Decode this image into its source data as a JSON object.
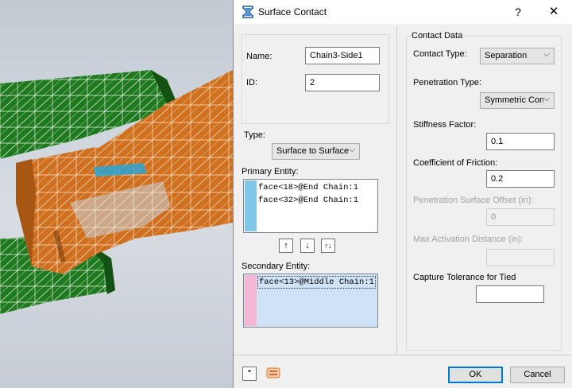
{
  "dialog": {
    "title": "Surface Contact",
    "help": "?",
    "close": "✕"
  },
  "general": {
    "name_label": "Name:",
    "name_value": "Chain3-Side1",
    "id_label": "ID:",
    "id_value": "2"
  },
  "type": {
    "label": "Type:",
    "value": "Surface to Surface"
  },
  "primary": {
    "label": "Primary Entity:",
    "items": [
      "face<18>@End Chain:1",
      "face<32>@End Chain:1"
    ]
  },
  "secondary": {
    "label": "Secondary Entity:",
    "items": [
      "face<13>@Middle Chain:1"
    ]
  },
  "list_buttons": {
    "up": "↑",
    "down": "↓",
    "swap": "↑↓"
  },
  "contact_data": {
    "group_label": "Contact Data",
    "contact_type_label": "Contact Type:",
    "contact_type_value": "Separation",
    "penetration_type_label": "Penetration Type:",
    "penetration_type_value": "Symmetric Cont",
    "stiffness_label": "Stiffness Factor:",
    "stiffness_value": "0.1",
    "friction_label": "Coefficient of Friction:",
    "friction_value": "0.2",
    "pen_offset_label": "Penetration Surface Offset (in):",
    "pen_offset_value": "0",
    "max_activation_label": "Max Activation Distance (in):",
    "max_activation_value": "",
    "capture_tolerance_label": "Capture Tolerance for Tied",
    "capture_tolerance_value": ""
  },
  "footer": {
    "ok": "OK",
    "cancel": "Cancel"
  },
  "colors": {
    "accent": "#0078d7",
    "primary_stripe": "#7fc6e8",
    "secondary_stripe": "#f5b8d4",
    "secondary_bg": "#cfe2f6",
    "mesh_green": "#1f7a1f",
    "mesh_orange": "#cc6a1a"
  }
}
